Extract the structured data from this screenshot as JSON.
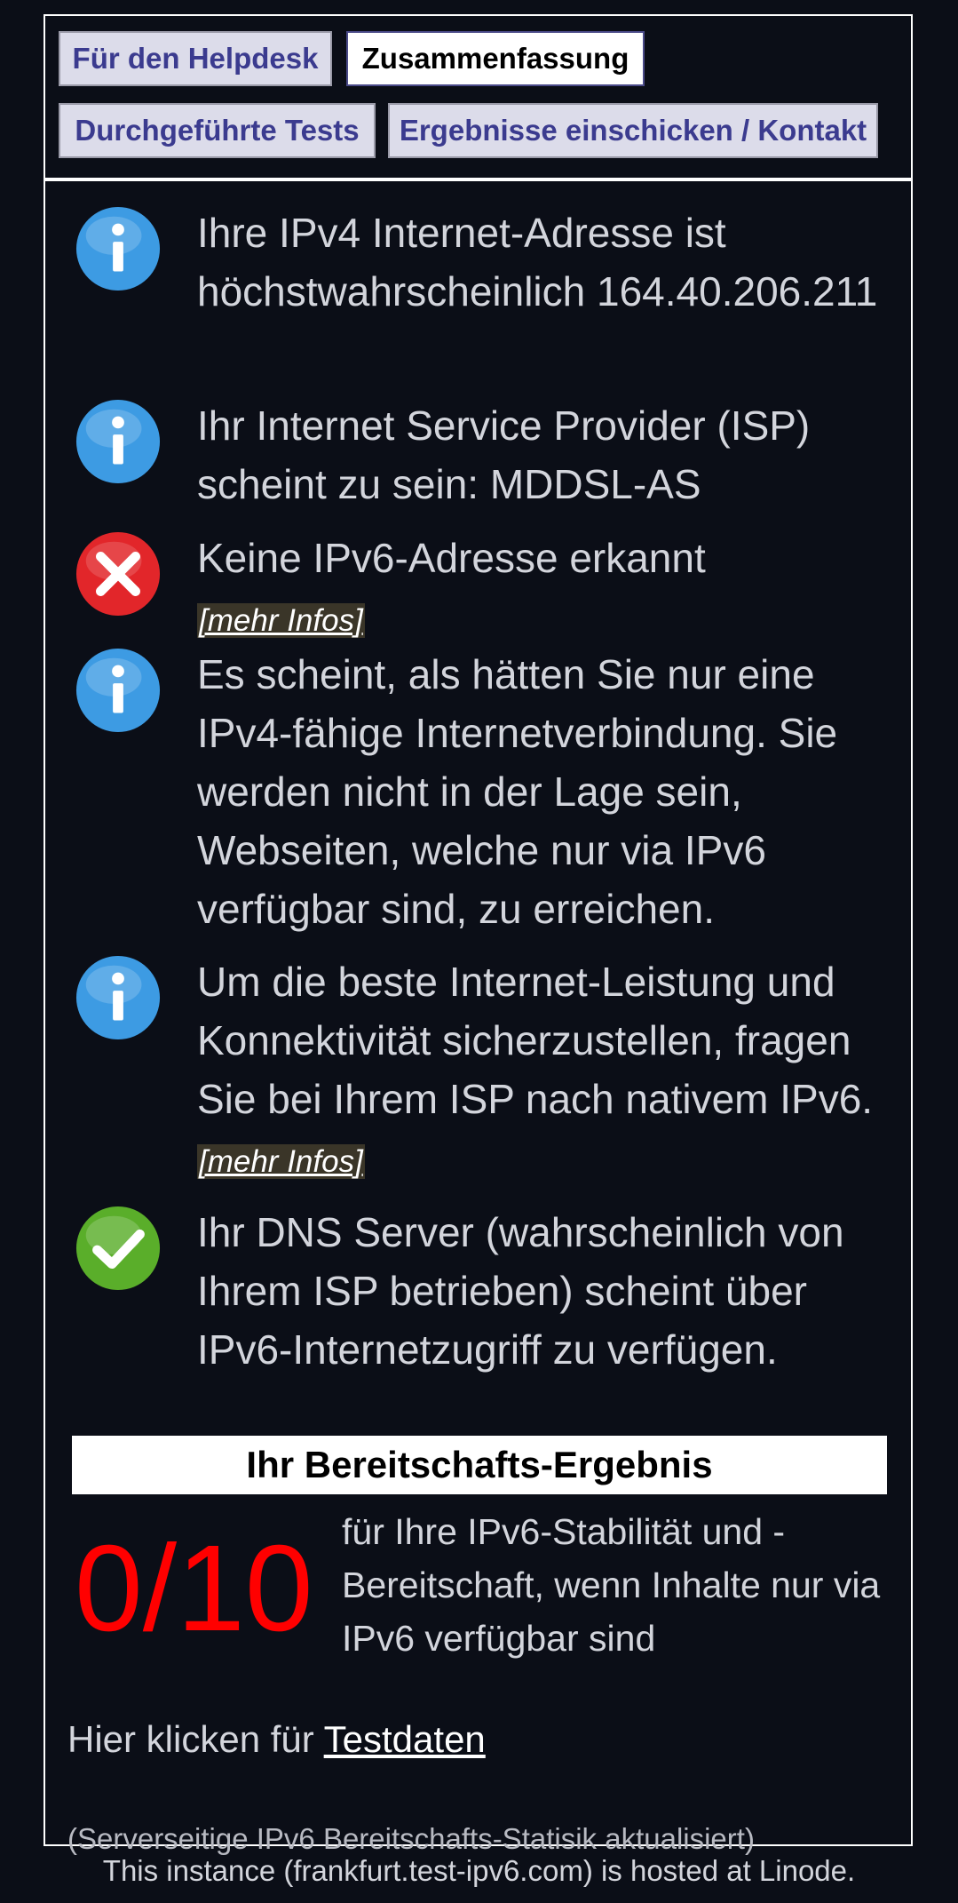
{
  "tabs": {
    "helpdesk": "Für den Helpdesk",
    "summary": "Zusammenfassung",
    "tests": "Durchgeführte Tests",
    "submit": "Ergebnisse einschicken / Kontakt"
  },
  "results": {
    "ipv4": "Ihre IPv4 Internet-Adresse ist höchstwahrscheinlich 164.40.206.211",
    "isp": "Ihr Internet Service Provider (ISP) scheint zu sein: MDDSL-AS",
    "no_ipv6": "Keine IPv6-Adresse erkannt",
    "no_ipv6_more": "[mehr Infos]",
    "ipv4_only": "Es scheint, als hätten Sie nur eine IPv4-fähige Internetverbindung. Sie werden nicht in der Lage sein, Webseiten, welche nur via IPv6 verfügbar sind, zu erreichen.",
    "ask_isp": "Um die beste Internet-Leistung und Konnektivität sicherzustellen, fragen Sie bei Ihrem ISP nach nativem IPv6.",
    "ask_isp_more": "[mehr Infos]",
    "dns": "Ihr DNS Server (wahrscheinlich von Ihrem ISP betrieben) scheint über IPv6-Internetzugriff zu verfügen."
  },
  "icons": {
    "info": "info-icon",
    "error": "error-x-icon",
    "ok": "check-icon"
  },
  "colors": {
    "info": "#3d9be3",
    "error": "#e2262a",
    "ok": "#5aae2a",
    "score": "#ff0000",
    "background": "#0b0e17"
  },
  "readiness": {
    "heading": "Ihr Bereitschafts-Ergebnis",
    "score": "0/10",
    "description": "für Ihre IPv6-Stabilität und -Bereitschaft, wenn Inhalte nur via IPv6 verfügbar sind"
  },
  "testdata": {
    "prefix": "Hier klicken für ",
    "link": "Testdaten"
  },
  "stats_note": "(Serverseitige IPv6 Bereitschafts-Statisik aktualisiert)",
  "footer": "This instance (frankfurt.test-ipv6.com) is hosted at Linode."
}
